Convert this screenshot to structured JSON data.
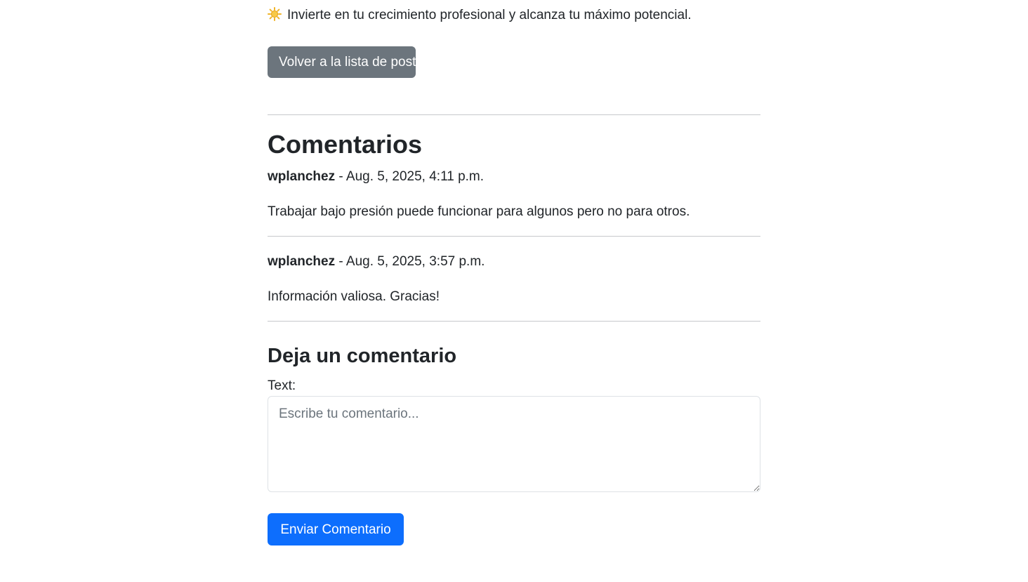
{
  "intro": {
    "text": "Invierte en tu crecimiento profesional y alcanza tu máximo potencial.",
    "icon": "sun-icon"
  },
  "back_button": {
    "label": "Volver a la lista de posts"
  },
  "comments": {
    "title": "Comentarios",
    "items": [
      {
        "author": "wplanchez",
        "date": " - Aug. 5, 2025, 4:11 p.m.",
        "text": "Trabajar bajo presión puede funcionar para algunos pero no para otros."
      },
      {
        "author": "wplanchez",
        "date": " - Aug. 5, 2025, 3:57 p.m.",
        "text": "Información valiosa. Gracias!"
      }
    ]
  },
  "form": {
    "title": "Deja un comentario",
    "label": "Text:",
    "placeholder": "Escribe tu comentario...",
    "value": "",
    "submit_label": "Enviar Comentario"
  },
  "colors": {
    "secondary": "#6c757d",
    "primary": "#0d6efd",
    "text": "#212529",
    "divider": "#c7c9cb"
  }
}
